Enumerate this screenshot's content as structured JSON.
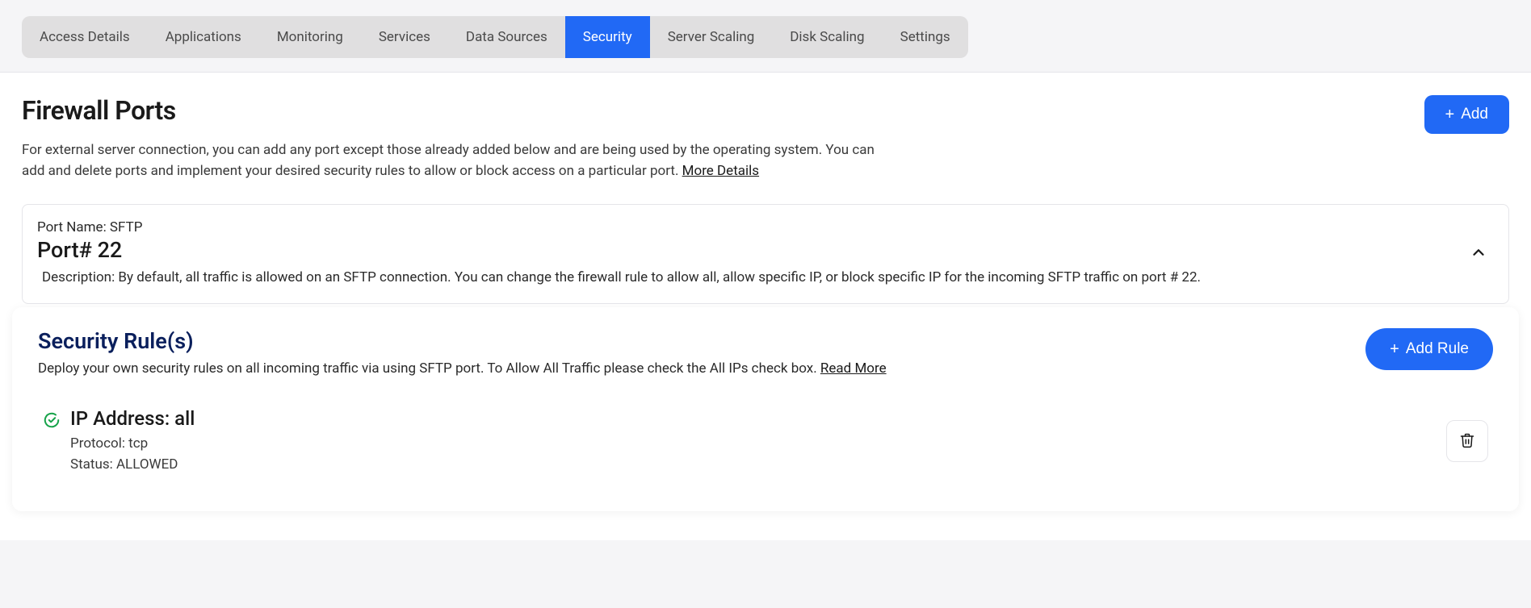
{
  "tabs": {
    "items": [
      {
        "label": "Access Details"
      },
      {
        "label": "Applications"
      },
      {
        "label": "Monitoring"
      },
      {
        "label": "Services"
      },
      {
        "label": "Data Sources"
      },
      {
        "label": "Security"
      },
      {
        "label": "Server Scaling"
      },
      {
        "label": "Disk Scaling"
      },
      {
        "label": "Settings"
      }
    ],
    "active_index": 5
  },
  "page": {
    "title": "Firewall Ports",
    "add_label": "Add",
    "description": "For external server connection, you can add any port except those already added below and are being used by the operating system. You can add and delete ports and implement your desired security rules to allow or block access on a particular port. ",
    "more_link": "More Details"
  },
  "port": {
    "name_label": "Port Name: ",
    "name_value": "SFTP",
    "number_label": "Port# ",
    "number_value": "22",
    "desc_label": "Description: ",
    "desc_value": "By default, all traffic is allowed on an SFTP connection. You can change the firewall rule to allow all, allow specific IP, or block specific IP for the incoming SFTP traffic on port # 22."
  },
  "rules": {
    "title": "Security Rule(s)",
    "desc": "Deploy your own security rules on all incoming traffic via using SFTP port. To Allow All Traffic please check the All IPs check box. ",
    "read_more": "Read More",
    "add_rule_label": "Add Rule",
    "items": [
      {
        "ip_label": "IP Address: ",
        "ip_value": "all",
        "protocol_label": "Protocol: ",
        "protocol_value": "tcp",
        "status_label": "Status: ",
        "status_value": "ALLOWED"
      }
    ]
  }
}
